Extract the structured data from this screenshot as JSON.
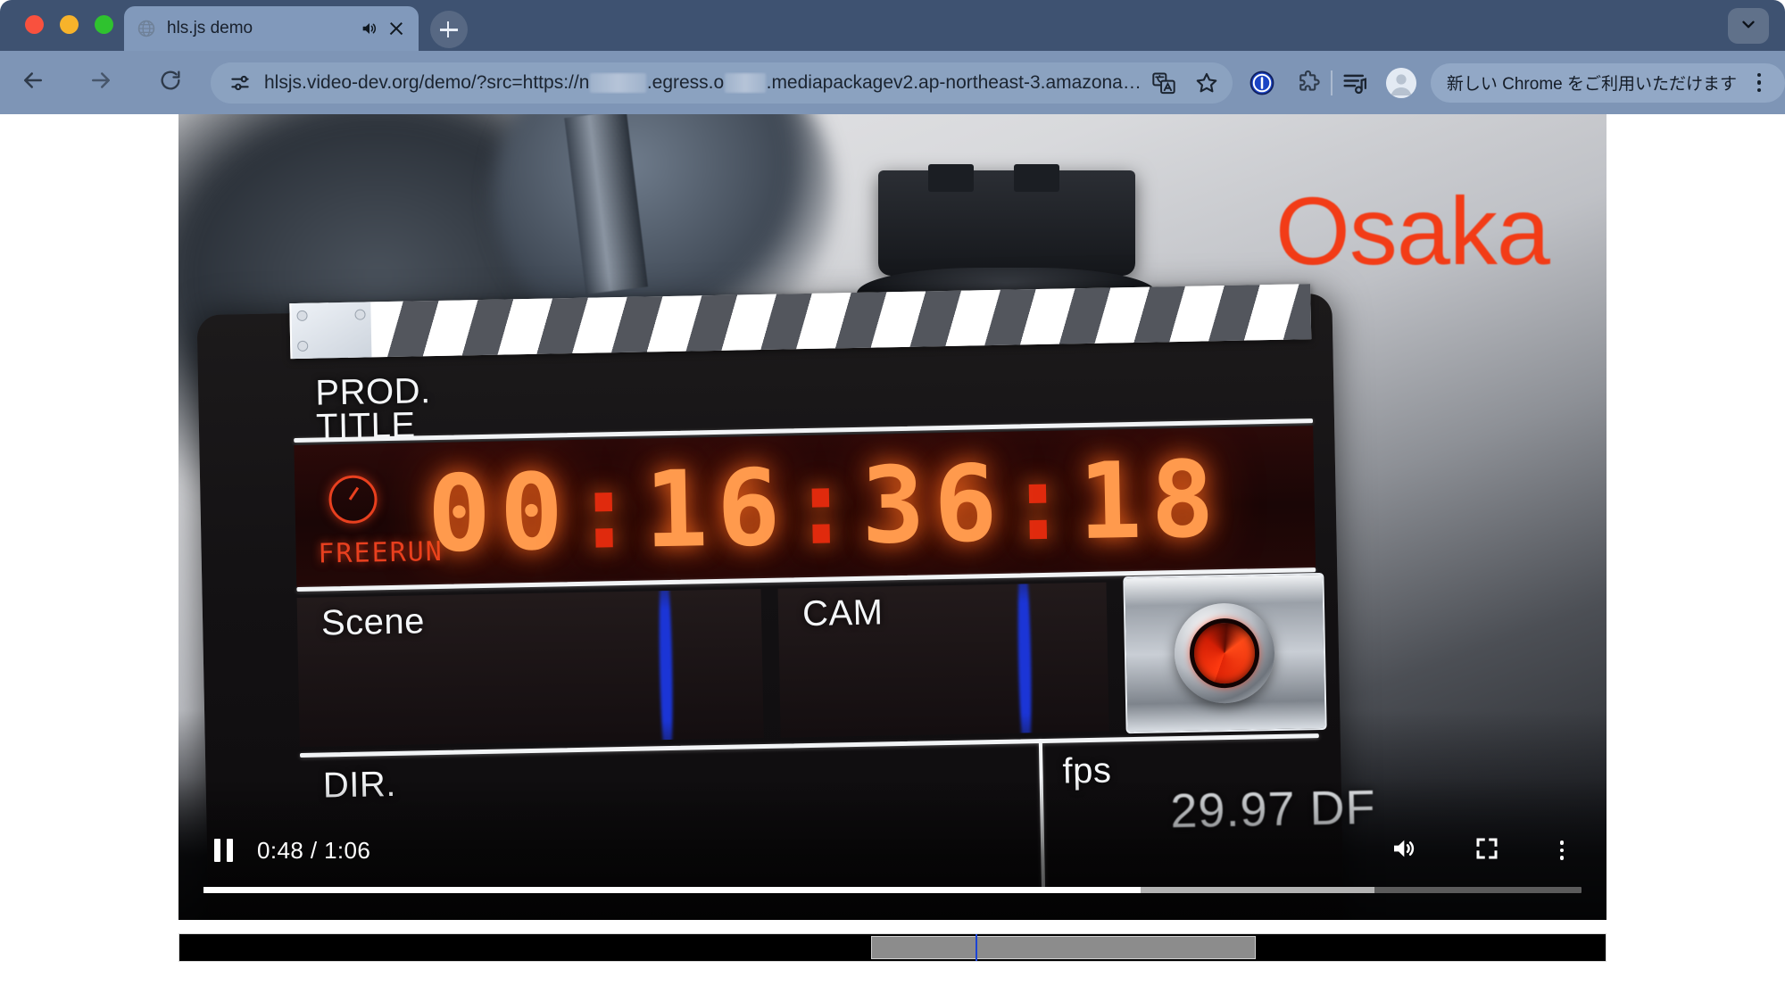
{
  "browser": {
    "window_controls": [
      "close",
      "minimize",
      "maximize"
    ],
    "tab": {
      "title": "hls.js demo",
      "favicon_icon": "globe-icon",
      "audio_icon": "speaker-playing-icon",
      "close_icon": "close-icon"
    },
    "new_tab_label": "+",
    "tab_search_icon": "chevron-down-icon",
    "toolbar": {
      "back_icon": "arrow-left-icon",
      "forward_icon": "arrow-right-icon",
      "reload_icon": "reload-icon",
      "site_info_icon": "tune-site-settings-icon",
      "url_prefix": "hlsjs.video-dev.org/demo/?src=https://n",
      "url_mid": ".egress.o",
      "url_suffix": ".mediapackagev2.ap-northeast-3.amazona…",
      "translate_icon": "translate-icon",
      "bookmark_icon": "star-icon",
      "password_manager_icon": "1password-icon",
      "extensions_icon": "extensions-puzzle-icon",
      "reading_list_icon": "reading-list-icon",
      "profile_icon": "avatar-icon",
      "promo_text": "新しい Chrome をご利用いただけます",
      "menu_icon": "kebab-menu-icon"
    }
  },
  "video": {
    "scene_text": {
      "location_sign": "Osaka",
      "prod_label": "PROD.",
      "title_label": "TITLE",
      "freerun_label": "FREERUN",
      "timecode": "00:16:36:18",
      "timecode_parts": [
        "00",
        "16",
        "36",
        "18"
      ],
      "timecode_separator": ":",
      "scene_label": "Scene",
      "cam_label": "CAM",
      "dir_label": "DIR.",
      "fps_label": "fps",
      "fps_value": "29.97 DF",
      "clock_icon": "clock-icon",
      "record_icon": "record-button-icon"
    },
    "controls": {
      "play_pause_icon": "pause-icon",
      "time_display": "0:48 / 1:06",
      "current_time": "0:48",
      "duration": "1:06",
      "volume_icon": "volume-on-icon",
      "fullscreen_icon": "fullscreen-icon",
      "more_options_icon": "kebab-menu-icon",
      "progress_played_pct": 68,
      "progress_buffered_pct": 85
    }
  },
  "buffer_timeline": {
    "buffered_start_pct": 48.5,
    "buffered_end_pct": 75.5,
    "playhead_pct": 55.8
  },
  "colors": {
    "tabstrip_bg": "#3e5271",
    "toolbar_bg": "#7e95b6",
    "omnibox_bg": "#8ba2c0",
    "page_bg": "#ffffff",
    "osaka_red": "#f23c17",
    "timecode_amber": "#ff9a4d",
    "timecode_colon": "#e02b0e",
    "progress_played": "#ffffff",
    "progress_buffered": "#b3b3b3",
    "playhead_blue": "#1b44d6"
  }
}
